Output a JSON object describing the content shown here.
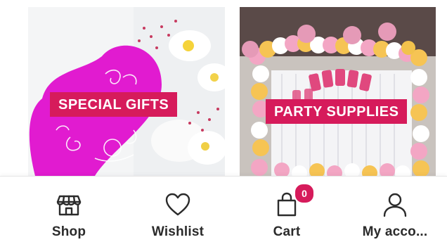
{
  "tiles": [
    {
      "label": "SPECIAL GIFTS"
    },
    {
      "label": "PARTY SUPPLIES"
    }
  ],
  "nav": {
    "items": [
      {
        "label": "Shop",
        "icon": "store-icon"
      },
      {
        "label": "Wishlist",
        "icon": "heart-icon"
      },
      {
        "label": "Cart",
        "icon": "shopping-bag-icon",
        "badge": "0"
      },
      {
        "label": "My acco...",
        "icon": "user-icon"
      }
    ]
  },
  "colors": {
    "accent": "#d61b5b",
    "heart_box": "#e11bd0"
  }
}
